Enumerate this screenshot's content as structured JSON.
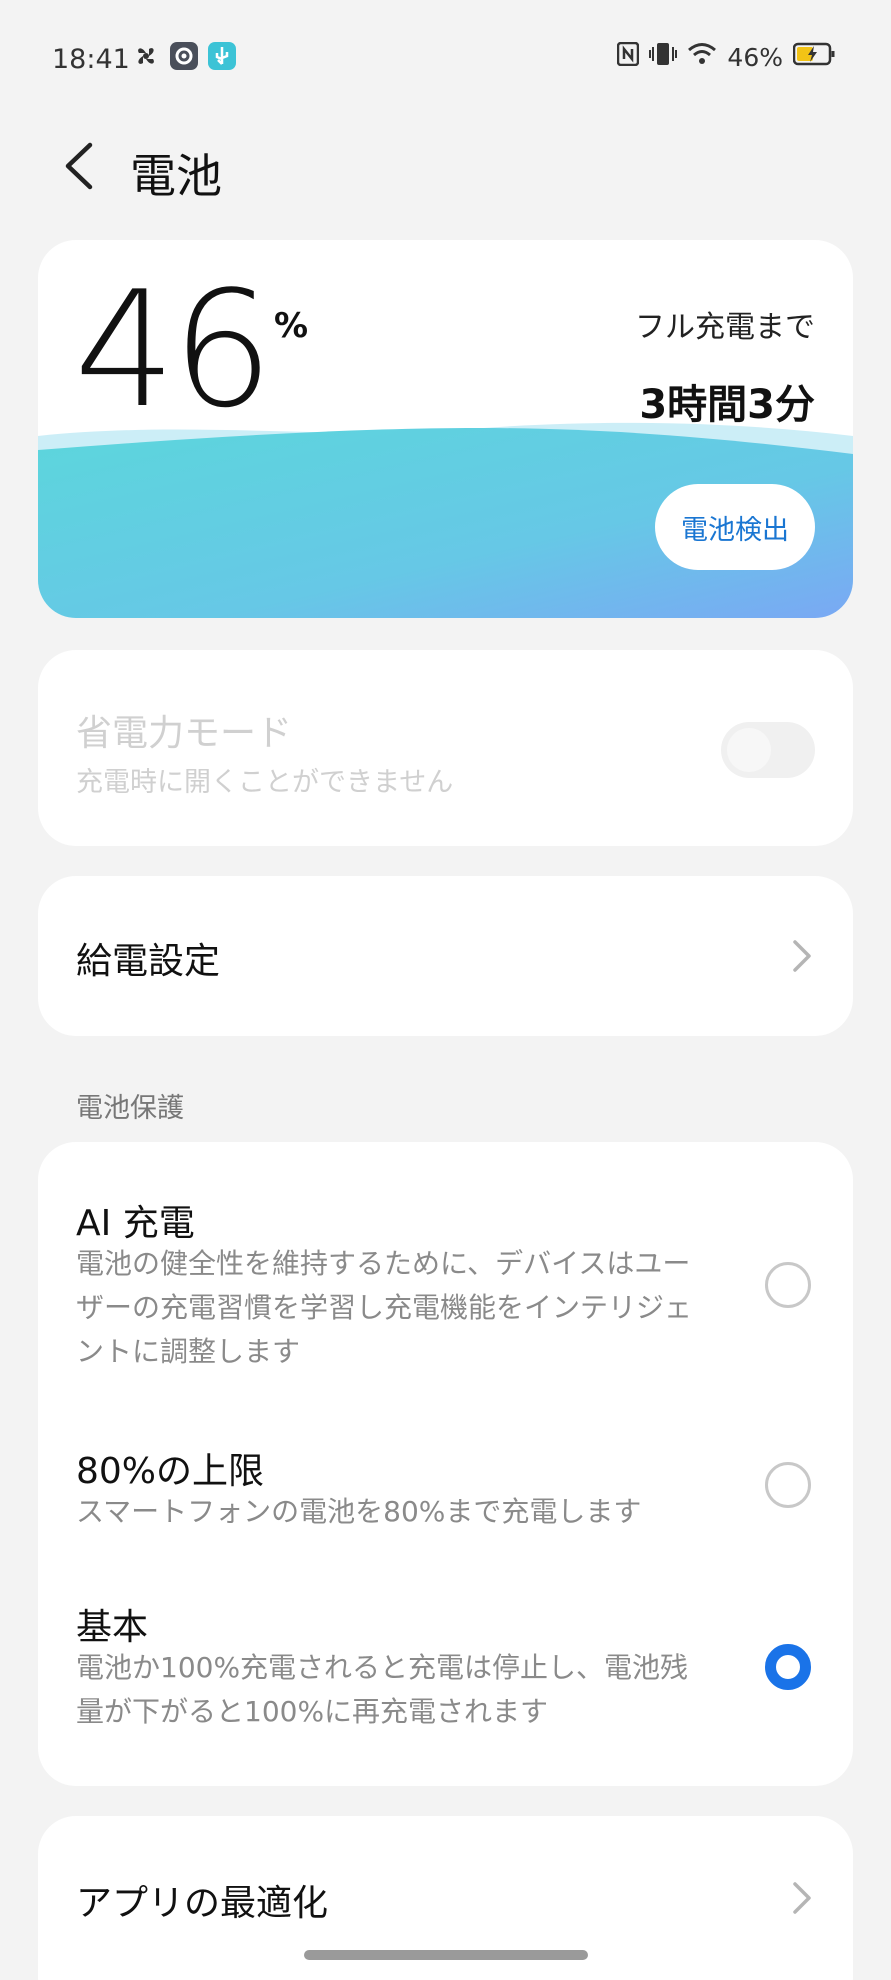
{
  "status": {
    "time": "18:41",
    "battery": "46%"
  },
  "header": {
    "title": "電池"
  },
  "battery": {
    "percent": "46",
    "unit": "%",
    "full_label": "フル充電まで",
    "full_time": "3時間3分",
    "check_label": "電池検出",
    "level": 0.46
  },
  "power_saving": {
    "title": "省電力モード",
    "subtitle": "充電時に開くことができません",
    "enabled": false
  },
  "power_settings": {
    "title": "給電設定"
  },
  "protection": {
    "section_label": "電池保護",
    "options": [
      {
        "title": "AI 充電",
        "desc": "電池の健全性を維持するために、デバイスはユーザーの充電習慣を学習し充電機能をインテリジェントに調整します",
        "selected": false
      },
      {
        "title": "80%の上限",
        "desc": "スマートフォンの電池を80%まで充電します",
        "selected": false
      },
      {
        "title": "基本",
        "desc": "電池か100%充電されると充電は停止し、電池残量が下がると100%に再充電されます",
        "selected": true
      }
    ]
  },
  "app_opt": {
    "title": "アプリの最適化"
  },
  "colors": {
    "accent": "#1a73e8",
    "wave_start": "#5cd6dc",
    "wave_end": "#7aa8f4"
  }
}
